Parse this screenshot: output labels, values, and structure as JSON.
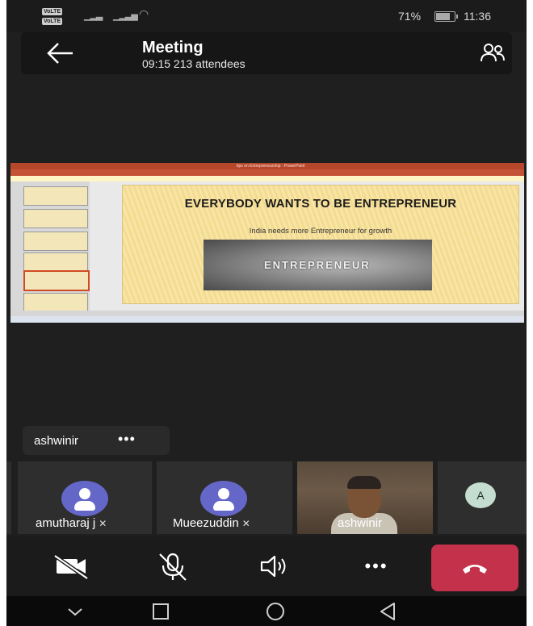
{
  "status_bar": {
    "volte_1": "VoLTE",
    "volte_2": "VoLTE",
    "battery_percent": "71%",
    "battery_level": 0.71,
    "time": "11:36"
  },
  "header": {
    "title": "Meeting",
    "subtitle": "09:15  213 attendees"
  },
  "shared_screen": {
    "window_title": "tips on Entrepreneurship - PowerPoint",
    "slide_title": "EVERYBODY WANTS TO BE ENTREPRENEUR",
    "slide_subtitle": "India needs more Entrepreneur for growth",
    "slide_image_text": "ENTREPRENEUR"
  },
  "name_chip": {
    "label": "ashwinir",
    "more": "•••"
  },
  "participants": [
    {
      "name": "amutharaj j",
      "mic_icon": "🎙"
    },
    {
      "name": "Mueezuddin",
      "mic_icon": "🎙"
    },
    {
      "name": "ashwinir"
    },
    {
      "initial": "A"
    }
  ],
  "controls": {
    "more_label": "•••"
  },
  "icons": {
    "back": "arrow-left-icon",
    "people": "people-icon",
    "camera_off": "camera-off-icon",
    "mic_off": "mic-off-icon",
    "speaker": "speaker-icon",
    "hang_up": "hang-up-icon"
  },
  "colors": {
    "avatar": "#6467c7",
    "end_call": "#c4314b",
    "ppt_accent": "#b7472a"
  }
}
